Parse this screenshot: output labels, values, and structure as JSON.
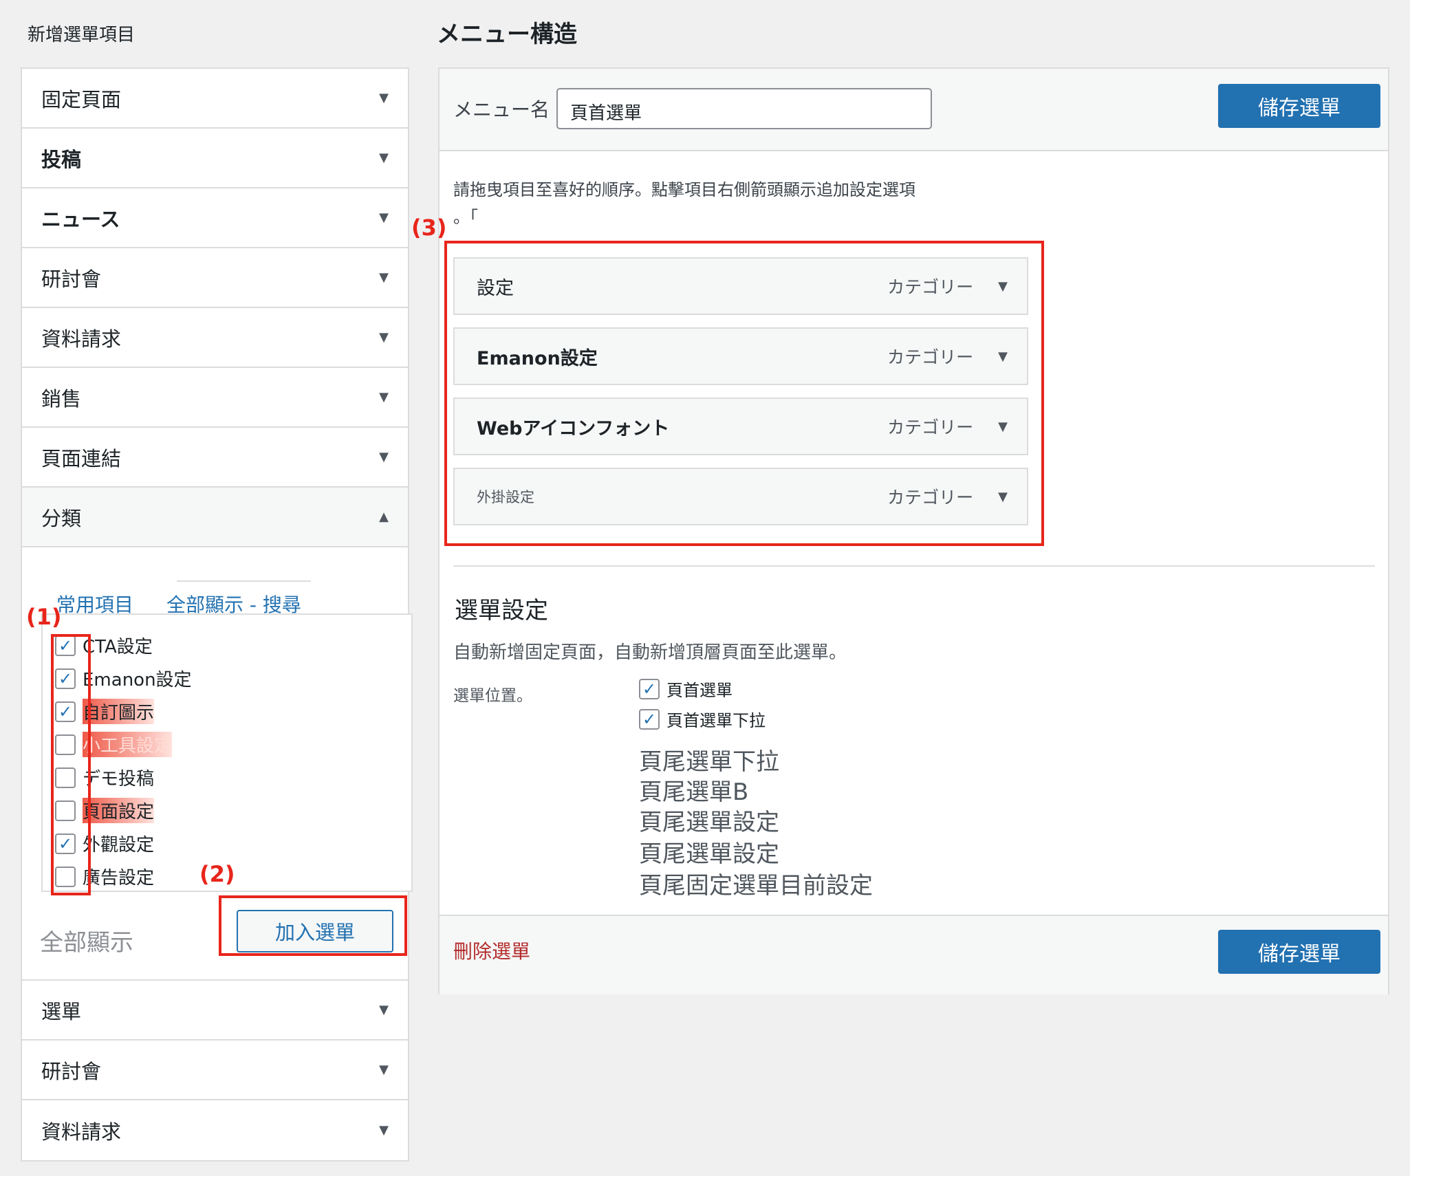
{
  "left": {
    "heading": "新增選單項目",
    "sections_top": [
      {
        "label": "固定頁面",
        "bold": false
      },
      {
        "label": "投稿",
        "bold": true
      },
      {
        "label": "ニュース",
        "bold": true
      },
      {
        "label": "研討會",
        "bold": false
      },
      {
        "label": "資料請求",
        "bold": false
      },
      {
        "label": "銷售",
        "bold": false
      },
      {
        "label": "頁面連結",
        "bold": false
      }
    ],
    "open_section": {
      "label": "分類",
      "tabs": [
        "常用項目",
        "全部顯示 - 搜尋"
      ],
      "items": [
        {
          "label": "CTA設定",
          "checked": true
        },
        {
          "label": "Emanon設定",
          "checked": true
        },
        {
          "label": "自訂圖示",
          "checked": true
        },
        {
          "label": "小工具設定",
          "checked": false
        },
        {
          "label": "デモ投稿",
          "checked": false
        },
        {
          "label": "頁面設定",
          "checked": false
        },
        {
          "label": "外觀設定",
          "checked": true
        },
        {
          "label": "廣告設定",
          "checked": false
        }
      ],
      "select_all": "全部顯示",
      "add_button": "加入選單"
    },
    "sections_bottom": [
      {
        "label": "選單"
      },
      {
        "label": "研討會"
      },
      {
        "label": "資料請求"
      }
    ],
    "arrow_down": "▼",
    "arrow_up": "▲"
  },
  "annotations": {
    "one": "(1)",
    "two": "(2)",
    "three": "(3)"
  },
  "right": {
    "heading": "メニュー構造",
    "menu_name_label": "メニュー名",
    "menu_name_value": "頁首選單",
    "save_label": "儲存選單",
    "instructions_line1": "請拖曳項目至喜好的順序。點擊項目右側箭頭顯示追加設定選項",
    "instructions_line2": "。「",
    "menu_items": [
      {
        "title": "設定",
        "type": "カテゴリー"
      },
      {
        "title": "Emanon設定",
        "type": "カテゴリー"
      },
      {
        "title": "Webアイコンフォント",
        "type": "カテゴリー"
      },
      {
        "title": "外掛設定",
        "type": "カテゴリー"
      }
    ],
    "settings": {
      "title": "選單設定",
      "auto_add": "自動新增固定頁面，自動新增頂層頁面至此選單。",
      "location_label": "選單位置。",
      "locations_checked": [
        {
          "label": "頁首選單",
          "checked": true
        },
        {
          "label": "頁首選單下拉",
          "checked": true
        }
      ],
      "locations_plain": [
        "頁尾選單下拉",
        "頁尾選單B",
        "頁尾選單設定",
        "頁尾選單設定",
        "頁尾固定選單目前設定"
      ]
    },
    "delete_label": "刪除選單"
  },
  "colors": {
    "accent": "#2271b1",
    "annotation": "#e8251b",
    "delete": "#b32d2e"
  }
}
